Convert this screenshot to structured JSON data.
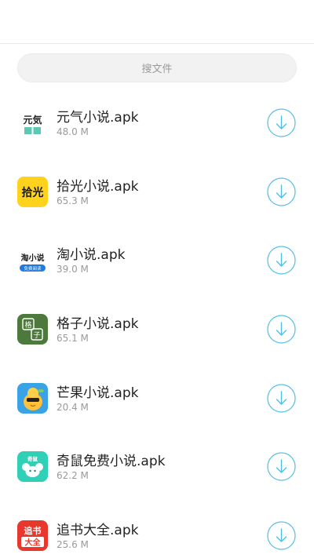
{
  "search": {
    "placeholder": "搜文件"
  },
  "files": [
    {
      "name": "元气小说.apk",
      "size": "48.0 M",
      "icon": "yuanqi-app-icon"
    },
    {
      "name": "拾光小说.apk",
      "size": "65.3 M",
      "icon": "shiguang-app-icon"
    },
    {
      "name": "淘小说.apk",
      "size": "39.0 M",
      "icon": "tao-app-icon"
    },
    {
      "name": "格子小说.apk",
      "size": "65.1 M",
      "icon": "gezi-app-icon"
    },
    {
      "name": "芒果小说.apk",
      "size": "20.4 M",
      "icon": "mangguo-app-icon"
    },
    {
      "name": "奇鼠免费小说.apk",
      "size": "62.2 M",
      "icon": "qishu-app-icon"
    },
    {
      "name": "追书大全.apk",
      "size": "25.6 M",
      "icon": "zhuishu-app-icon"
    }
  ],
  "icon_text": {
    "yuanqi": "元気",
    "shiguang": "拾光",
    "tao": "淘小说",
    "tao_badge": "免费阅读",
    "gezi_top": "格",
    "gezi_bottom": "子",
    "qishu": "奇鼠",
    "zhuishu_top": "追书",
    "zhuishu_bottom": "大全"
  },
  "colors": {
    "accent": "#4dbfe9",
    "tao_blue": "#1f7be0",
    "gezi_green": "#4d7a3c",
    "shiguang_yellow": "#ffd21e",
    "mangguo_blue": "#3aa3e6",
    "qishu_teal": "#2fd0b6",
    "zhuishu_red": "#e8372c",
    "yuanqi_teal": "#5ec8b5"
  }
}
